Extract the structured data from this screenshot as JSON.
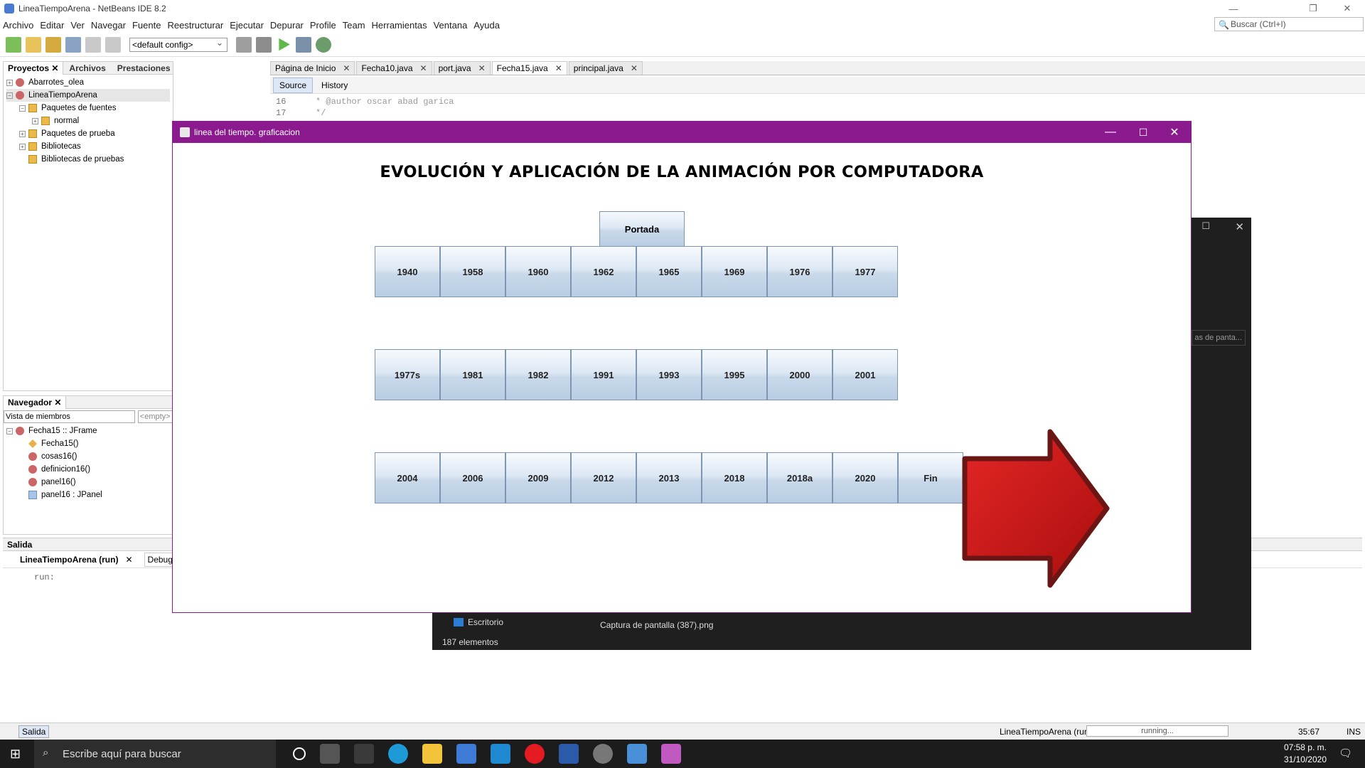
{
  "app": {
    "title": "LineaTiempoArena - NetBeans IDE 8.2"
  },
  "menu": [
    "Archivo",
    "Editar",
    "Ver",
    "Navegar",
    "Fuente",
    "Reestructurar",
    "Ejecutar",
    "Depurar",
    "Profile",
    "Team",
    "Herramientas",
    "Ventana",
    "Ayuda"
  ],
  "search": {
    "placeholder": "Buscar (Ctrl+I)"
  },
  "toolbar": {
    "config": "<default config>"
  },
  "projects": {
    "tabs": [
      "Proyectos",
      "Archivos",
      "Prestaciones"
    ],
    "items": [
      "Abarrotes_olea",
      "LineaTiempoArena",
      "Paquetes de fuentes",
      "normal",
      "Paquetes de prueba",
      "Bibliotecas",
      "Bibliotecas de pruebas"
    ]
  },
  "navigator": {
    "title": "Navegador",
    "view": "Vista de miembros",
    "filter": "<empty>",
    "root": "Fecha15 :: JFrame",
    "members": [
      "Fecha15()",
      "cosas16()",
      "definicion16()",
      "panel16()",
      "panel16 : JPanel"
    ]
  },
  "editor": {
    "tabs": [
      "Página de Inicio",
      "Fecha10.java",
      "port.java",
      "Fecha15.java",
      "principal.java"
    ],
    "source": "Source",
    "history": "History",
    "lines": [
      {
        "n": "16",
        "text": "* @author oscar abad garica"
      },
      {
        "n": "17",
        "text": "*/"
      }
    ]
  },
  "output": {
    "title": "Salida",
    "tab": "LineaTiempoArena (run)",
    "tab2": "Debugg",
    "text": "run:"
  },
  "jframe": {
    "title": "linea del tiempo. graficacion",
    "heading": "EVOLUCIÓN Y APLICACIÓN DE LA ANIMACIÓN POR COMPUTADORA",
    "portada": "Portada",
    "row1": [
      "1940",
      "1958",
      "1960",
      "1962",
      "1965",
      "1969",
      "1976",
      "1977"
    ],
    "row2": [
      "1977s",
      "1981",
      "1982",
      "1991",
      "1993",
      "1995",
      "2000",
      "2001"
    ],
    "row3": [
      "2004",
      "2006",
      "2009",
      "2012",
      "2013",
      "2018",
      "2018a",
      "2020",
      "Fin"
    ],
    "arrow_color": "#cc1a1a"
  },
  "explorer": {
    "search_hint": "as de panta...",
    "nav_item": "Escritorio",
    "file": "Captura de pantalla (387).png",
    "count": "187 elementos"
  },
  "status": {
    "project": "LineaTiempoArena (run)",
    "state": "running...",
    "pos": "35:67",
    "mode": "INS",
    "salida": "Salida"
  },
  "taskbar": {
    "search": "Escribe aquí para buscar",
    "time": "07:58 p. m.",
    "date": "31/10/2020"
  }
}
